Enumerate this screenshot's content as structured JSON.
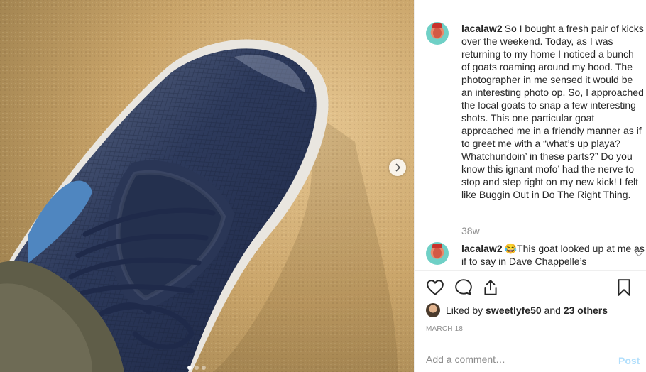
{
  "post": {
    "caption": {
      "username": "lacalaw2",
      "text": "So I bought a fresh pair of kicks over the weekend. Today, as I was returning to my home I noticed a bunch of goats roaming around my hood. The photographer in me sensed it would be an interesting photo op. So, I approached the local goats to snap a few interesting shots. This one particular goat approached me in a friendly manner as if to greet me with a “what’s up playa? Whatchundoin’ in these parts?” Do you know this ignant mofo’ had the nerve to stop and step right on my new kick! I felt like Buggin Out in Do The Right Thing.",
      "timestamp": "38w"
    },
    "reply": {
      "username": "lacalaw2",
      "emoji": "😂",
      "text": "This goat looked up at me as if to say in Dave Chappelle’s"
    },
    "likes": {
      "prefix": "Liked by",
      "liker": "sweetlyfe50",
      "conjunction": "and",
      "others": "23 others"
    },
    "date": "MARCH 18",
    "add_comment": {
      "placeholder": "Add a comment…",
      "post_label": "Post"
    }
  },
  "colors": {
    "accent_disabled": "#b2dffc",
    "muted": "#8e8e8e",
    "text": "#262626",
    "divider": "#efefef"
  },
  "icons": [
    "chevron-right-icon",
    "heart-icon",
    "comment-icon",
    "share-icon",
    "bookmark-icon"
  ]
}
